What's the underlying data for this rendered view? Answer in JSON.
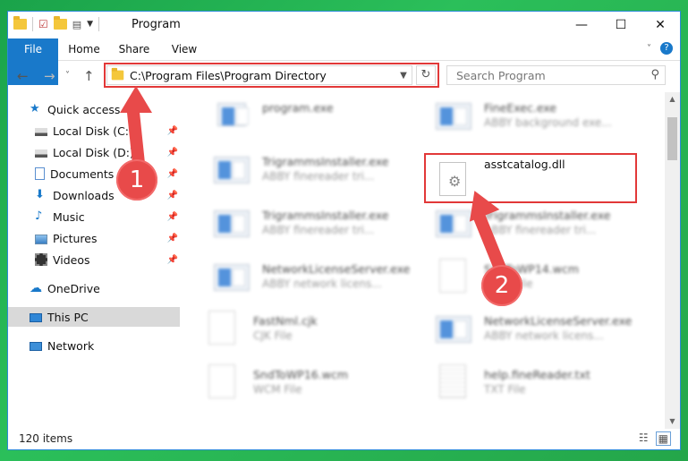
{
  "window": {
    "title": "Program",
    "buttons": {
      "minimize": "—",
      "maximize": "☐",
      "close": "✕"
    }
  },
  "ribbon": {
    "tabs": [
      {
        "label": "File"
      },
      {
        "label": "Home"
      },
      {
        "label": "Share"
      },
      {
        "label": "View"
      }
    ],
    "help": "?"
  },
  "navigation": {
    "back": "←",
    "forward": "→",
    "recent": "˅",
    "up": "↑"
  },
  "address": {
    "path": "C:\\Program Files\\Program Directory"
  },
  "search": {
    "placeholder": "Search Program"
  },
  "sidebar": {
    "items": [
      {
        "label": "Quick access"
      },
      {
        "label": "Local Disk (C:)"
      },
      {
        "label": "Local Disk (D:)"
      },
      {
        "label": "Documents"
      },
      {
        "label": "Downloads"
      },
      {
        "label": "Music"
      },
      {
        "label": "Pictures"
      },
      {
        "label": "Videos"
      },
      {
        "label": "OneDrive"
      },
      {
        "label": "This PC"
      },
      {
        "label": "Network"
      }
    ]
  },
  "files": [
    {
      "name": "program.exe",
      "desc": ""
    },
    {
      "name": "FineExec.exe",
      "desc": "ABBY background exe..."
    },
    {
      "name": "TrigrammsInstaller.exe",
      "desc": "ABBY finereader tri..."
    },
    {
      "name": "asstcatalog.dll",
      "desc": ""
    },
    {
      "name": "TrigrammsInstaller.exe",
      "desc": "ABBY finereader tri..."
    },
    {
      "name": "TrigrammsInstaller.exe",
      "desc": "ABBY finereader tri..."
    },
    {
      "name": "NetworkLicenseServer.exe",
      "desc": "ABBY network licens..."
    },
    {
      "name": "SndToWP14.wcm",
      "desc": "WCM File"
    },
    {
      "name": "FastNml.cjk",
      "desc": "CJK File"
    },
    {
      "name": "NetworkLicenseServer.exe",
      "desc": "ABBY network licens..."
    },
    {
      "name": "SndToWP16.wcm",
      "desc": "WCM File"
    },
    {
      "name": "help.fineReader.txt",
      "desc": "TXT File"
    }
  ],
  "status": {
    "count": "120 items"
  },
  "callouts": {
    "step1": "1",
    "step2": "2"
  },
  "colors": {
    "accent": "#1979ca",
    "highlight": "#e23838",
    "callout": "#e84a4a"
  }
}
